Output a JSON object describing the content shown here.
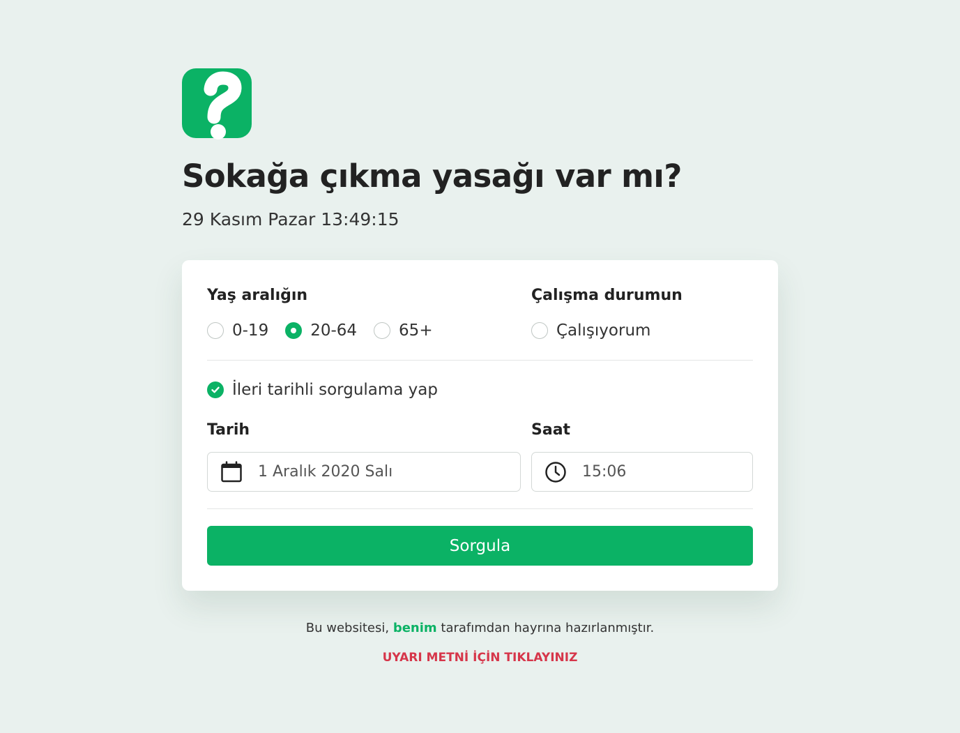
{
  "header": {
    "title": "Sokağa çıkma yasağı var mı?",
    "datetime": "29 Kasım Pazar 13:49:15"
  },
  "form": {
    "age": {
      "label": "Yaş aralığın",
      "options": [
        {
          "label": "0-19",
          "checked": false
        },
        {
          "label": "20-64",
          "checked": true
        },
        {
          "label": "65+",
          "checked": false
        }
      ]
    },
    "work": {
      "label": "Çalışma durumun",
      "option": {
        "label": "Çalışıyorum",
        "checked": false
      }
    },
    "future_query": {
      "label": "İleri tarihli sorgulama yap",
      "checked": true
    },
    "date": {
      "label": "Tarih",
      "value": "1 Aralık 2020 Salı"
    },
    "time": {
      "label": "Saat",
      "value": "15:06"
    },
    "submit_label": "Sorgula"
  },
  "footer": {
    "prefix": "Bu websitesi,",
    "link": "benim",
    "suffix": "tarafımdan hayrına hazırlanmıştır.",
    "warning": "UYARI METNİ İÇİN TIKLAYINIZ"
  },
  "colors": {
    "accent": "#0bb265",
    "background": "#e9f1ee",
    "warning": "#d6364a"
  }
}
